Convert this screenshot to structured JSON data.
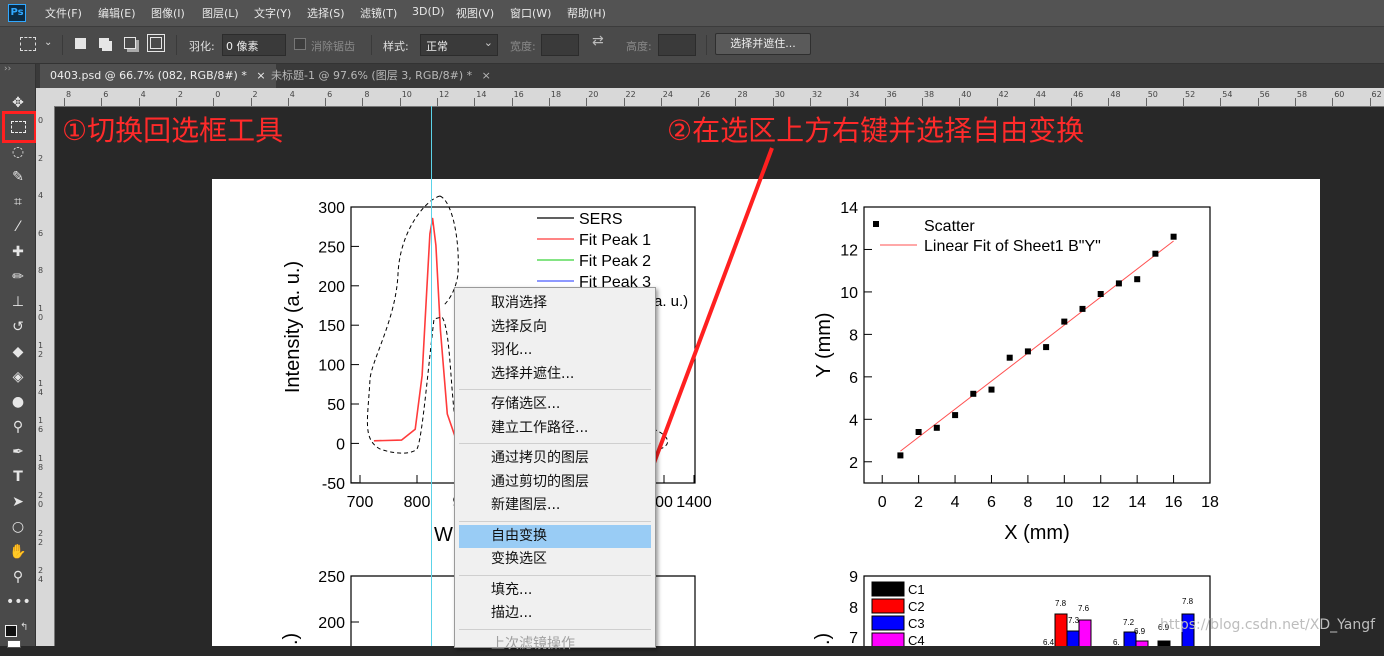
{
  "app": {
    "logo": "Ps"
  },
  "menu": [
    "文件(F)",
    "编辑(E)",
    "图像(I)",
    "图层(L)",
    "文字(Y)",
    "选择(S)",
    "滤镜(T)",
    "3D(D)",
    "视图(V)",
    "窗口(W)",
    "帮助(H)"
  ],
  "options": {
    "feather_label": "羽化:",
    "feather_value": "0 像素",
    "antialias_label": "消除锯齿",
    "style_label": "样式:",
    "style_value": "正常",
    "width_label": "宽度:",
    "height_label": "高度:",
    "select_mask_button": "选择并遮住..."
  },
  "tabs": [
    {
      "label": "0403.psd @ 66.7% (082, RGB/8#) *",
      "close": "×",
      "active": true
    },
    {
      "label": "未标题-1 @ 97.6% (图层 3, RGB/8#) *",
      "close": "×",
      "active": false
    }
  ],
  "ruler": {
    "top": [
      "8",
      "6",
      "4",
      "2",
      "0",
      "2",
      "4",
      "6",
      "8",
      "10",
      "12",
      "14",
      "16",
      "18",
      "20",
      "22",
      "24",
      "26",
      "28",
      "30",
      "32",
      "34",
      "36",
      "38",
      "40",
      "42",
      "44",
      "46",
      "48",
      "50",
      "52",
      "54",
      "56",
      "58",
      "60",
      "62"
    ],
    "left": [
      "0",
      "2",
      "4",
      "6",
      "8",
      "1 0",
      "1 2",
      "1 4",
      "1 6",
      "1 8",
      "2 0",
      "2 2",
      "2 4"
    ]
  },
  "annotations": {
    "step1": "①切换回选框工具",
    "step2": "②在选区上方右键并选择自由变换"
  },
  "context_menu": {
    "items": [
      {
        "label": "取消选择",
        "state": "normal"
      },
      {
        "label": "选择反向",
        "state": "normal"
      },
      {
        "label": "羽化...",
        "state": "normal"
      },
      {
        "label": "选择并遮住...",
        "state": "normal"
      },
      {
        "label": "存储选区...",
        "state": "normal"
      },
      {
        "label": "建立工作路径...",
        "state": "normal"
      },
      {
        "label": "通过拷贝的图层",
        "state": "normal"
      },
      {
        "label": "通过剪切的图层",
        "state": "normal"
      },
      {
        "label": "新建图层...",
        "state": "normal"
      },
      {
        "label": "自由变换",
        "state": "highlighted"
      },
      {
        "label": "变换选区",
        "state": "normal"
      },
      {
        "label": "填充...",
        "state": "normal"
      },
      {
        "label": "描边...",
        "state": "normal"
      },
      {
        "label": "上次滤镜操作",
        "state": "disabled"
      }
    ]
  },
  "canvas": {
    "plot1": {
      "ylabel": "Intensity (a. u.)",
      "xlabel_visible": "W",
      "yticks": [
        "300",
        "250",
        "200",
        "150",
        "100",
        "50",
        "0",
        "-50"
      ],
      "xticks_left": [
        "700",
        "800",
        "9"
      ],
      "xticks_right": [
        "00",
        "1400"
      ],
      "partial_label": "a. u.)",
      "legend": [
        "SERS",
        "Fit Peak 1",
        "Fit Peak 2",
        "Fit Peak 3"
      ]
    },
    "plot2": {
      "xlabel": "X (mm)",
      "ylabel": "Y (mm)",
      "xticks": [
        "0",
        "2",
        "4",
        "6",
        "8",
        "10",
        "12",
        "14",
        "16",
        "18"
      ],
      "yticks": [
        "14",
        "12",
        "10",
        "8",
        "6",
        "4",
        "2"
      ],
      "legend": [
        "Scatter",
        "Linear Fit of Sheet1 B\"Y\""
      ]
    },
    "plot3": {
      "yticks": [
        "250",
        "200"
      ],
      "ylabel_partial": ".)"
    },
    "plot4": {
      "yticks": [
        "9",
        "8",
        "7"
      ],
      "ylabel_partial": ".)",
      "legend": [
        "C1",
        "C2",
        "C3",
        "C4"
      ],
      "bar_labels": [
        "7.8",
        "7.6",
        "7.3",
        "7.2",
        "6.9",
        "6.9",
        "7.8",
        "6.4",
        "6."
      ]
    }
  },
  "colors": {
    "accent_red": "#ff2a2a",
    "highlight": "#99ccf5",
    "guide": "#5cd3e8"
  },
  "chart_data": [
    {
      "type": "line",
      "xlim": [
        650,
        1400
      ],
      "ylim": [
        -50,
        310
      ],
      "series": [
        {
          "name": "SERS",
          "x": [],
          "y": []
        },
        {
          "name": "Fit Peak 1",
          "x": [
            700,
            760,
            790,
            805,
            815,
            822,
            828,
            835,
            845,
            860,
            880
          ],
          "y": [
            5,
            6,
            20,
            90,
            200,
            275,
            295,
            260,
            150,
            40,
            5
          ]
        },
        {
          "name": "Fit Peak 2",
          "x": [],
          "y": []
        },
        {
          "name": "Fit Peak 3",
          "x": [],
          "y": []
        }
      ]
    },
    {
      "type": "scatter",
      "xlim": [
        -1,
        18
      ],
      "ylim": [
        1,
        14
      ],
      "series": [
        {
          "name": "Scatter",
          "x": [
            1,
            2,
            3,
            4,
            5,
            6,
            7,
            8,
            9,
            10,
            11,
            12,
            13,
            14,
            15,
            16
          ],
          "y": [
            2.3,
            3.4,
            3.6,
            4.2,
            5.2,
            5.4,
            6.9,
            7.2,
            7.4,
            8.6,
            9.2,
            9.9,
            10.4,
            10.6,
            11.8,
            12.6
          ]
        },
        {
          "name": "Linear Fit of Sheet1 B\"Y\"",
          "x": [
            1,
            16
          ],
          "y": [
            2.5,
            12.4
          ]
        }
      ]
    }
  ]
}
